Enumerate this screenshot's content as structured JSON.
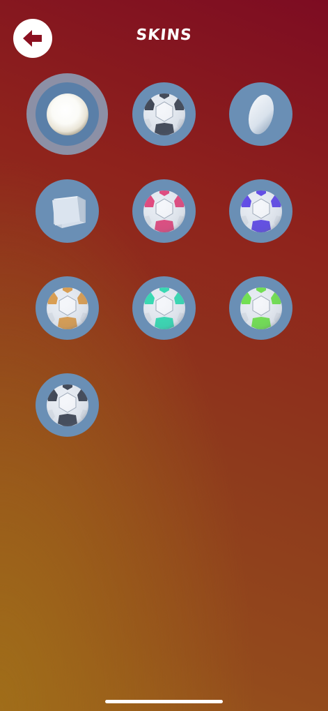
{
  "header": {
    "title": "SKINS",
    "back_icon": "arrow-left-icon"
  },
  "colors": {
    "slot_fill": "#6a8fb5",
    "selected_ring": "#8ca5be",
    "back_arrow": "#8b1020",
    "ball_dark": "#3a4150"
  },
  "skins": [
    {
      "name": "white-sphere",
      "icon": "sphere-icon",
      "selected": true
    },
    {
      "name": "soccer-ball-black",
      "icon": "soccer-ball-icon",
      "accent": "#3a4150"
    },
    {
      "name": "egg",
      "icon": "egg-icon"
    },
    {
      "name": "cube",
      "icon": "cube-icon"
    },
    {
      "name": "soccer-ball-pink",
      "icon": "soccer-ball-icon",
      "accent": "#e0437a"
    },
    {
      "name": "soccer-ball-purple",
      "icon": "soccer-ball-icon",
      "accent": "#5b45e6"
    },
    {
      "name": "soccer-ball-orange",
      "icon": "soccer-ball-icon",
      "accent": "#d99a4a"
    },
    {
      "name": "soccer-ball-teal",
      "icon": "soccer-ball-icon",
      "accent": "#2fd9b0"
    },
    {
      "name": "soccer-ball-green",
      "icon": "soccer-ball-icon",
      "accent": "#6ce04a"
    },
    {
      "name": "soccer-ball-black-2",
      "icon": "soccer-ball-icon",
      "accent": "#3a4150"
    }
  ]
}
